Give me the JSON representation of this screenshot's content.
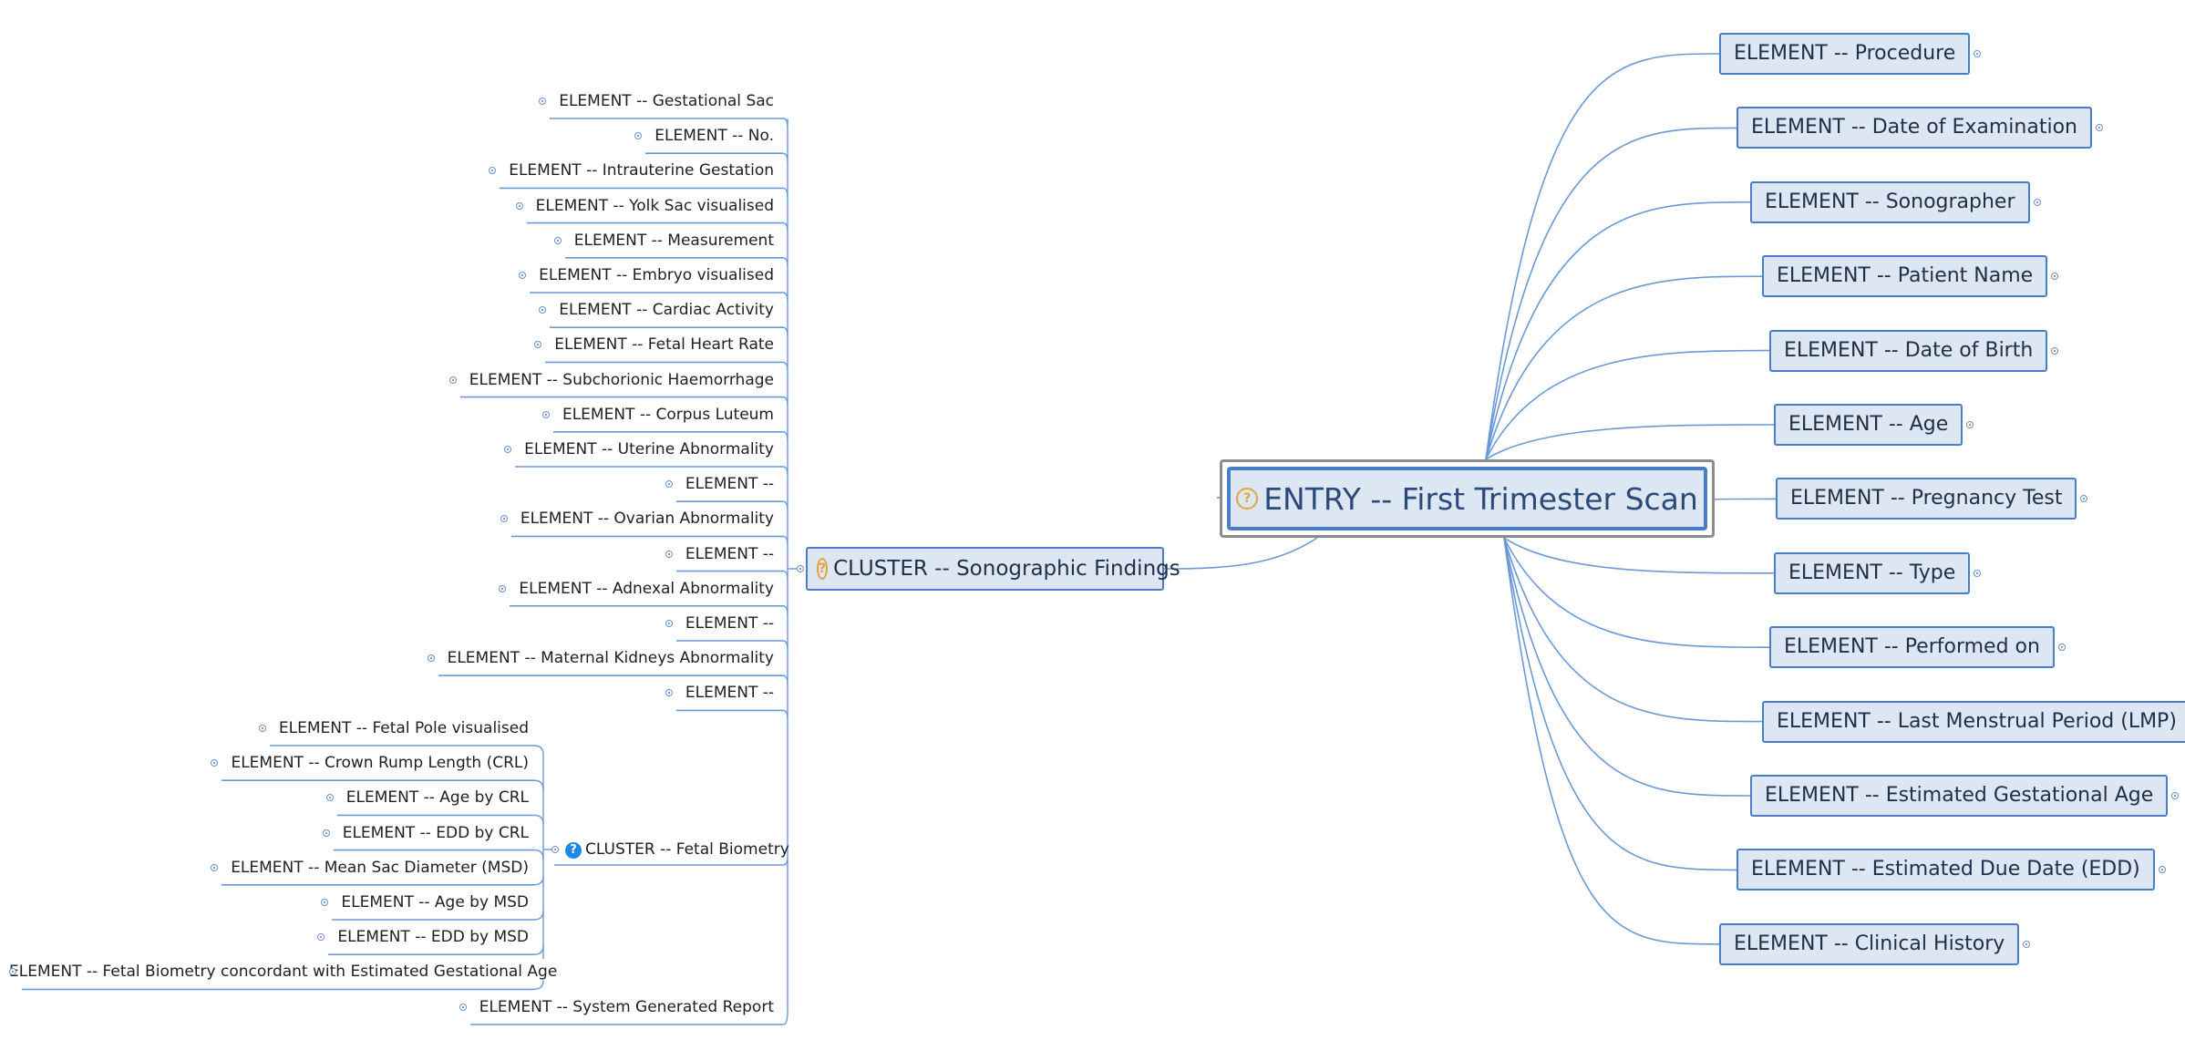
{
  "root": {
    "title": "ENTRY -- First Trimester Scan"
  },
  "right_elements": [
    "ELEMENT -- Procedure",
    "ELEMENT -- Date of Examination",
    "ELEMENT -- Sonographer",
    "ELEMENT -- Patient Name",
    "ELEMENT -- Date of Birth",
    "ELEMENT -- Age",
    "ELEMENT -- Pregnancy Test",
    "ELEMENT -- Type",
    "ELEMENT -- Performed on",
    "ELEMENT -- Last Menstrual Period (LMP)",
    "ELEMENT -- Estimated Gestational Age",
    "ELEMENT -- Estimated Due Date (EDD)",
    "ELEMENT -- Clinical History"
  ],
  "sonographic_cluster": {
    "title": "CLUSTER -- Sonographic Findings",
    "elements": [
      "ELEMENT -- Gestational Sac",
      "ELEMENT -- No.",
      "ELEMENT -- Intrauterine Gestation",
      "ELEMENT -- Yolk Sac visualised",
      "ELEMENT -- Measurement",
      "ELEMENT -- Embryo visualised",
      "ELEMENT -- Cardiac Activity",
      "ELEMENT -- Fetal Heart Rate",
      "ELEMENT -- Subchorionic Haemorrhage",
      "ELEMENT -- Corpus Luteum",
      "ELEMENT -- Uterine Abnormality",
      "ELEMENT --",
      "ELEMENT -- Ovarian Abnormality",
      "ELEMENT --",
      "ELEMENT -- Adnexal Abnormality",
      "ELEMENT --",
      "ELEMENT -- Maternal Kidneys Abnormality",
      "ELEMENT --"
    ],
    "trailing_element": "ELEMENT -- System Generated Report"
  },
  "fetal_cluster": {
    "title": "CLUSTER -- Fetal Biometry",
    "elements": [
      "ELEMENT -- Fetal Pole visualised",
      "ELEMENT -- Crown Rump Length (CRL)",
      "ELEMENT -- Age by CRL",
      "ELEMENT -- EDD by CRL",
      "ELEMENT -- Mean Sac Diameter (MSD)",
      "ELEMENT -- Age by MSD",
      "ELEMENT -- EDD by MSD",
      "ELEMENT -- Fetal Biometry concordant with Estimated Gestational Age"
    ]
  },
  "colors": {
    "line": "#6a9ad6",
    "node_fill": "#dde7f4",
    "node_border": "#4a7ec4",
    "question_icon": "#e6a23c",
    "help_icon": "#1e88e5"
  },
  "icons": {
    "root": "question-outline-icon",
    "sonographic_cluster": "question-outline-icon",
    "fetal_cluster": "help-circle-icon",
    "expander": "expand-dot-icon"
  }
}
